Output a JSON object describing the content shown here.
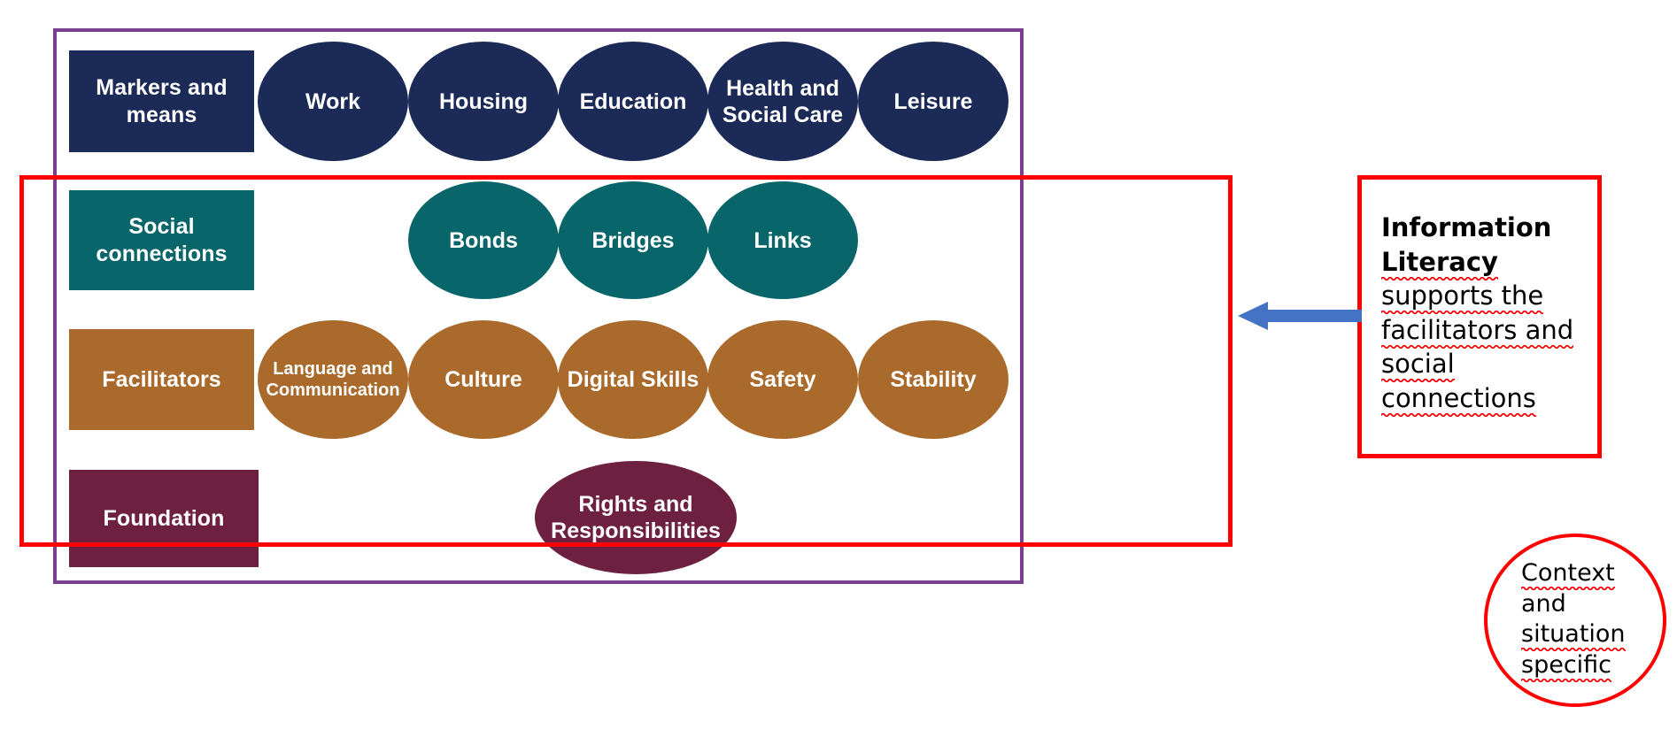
{
  "diagram": {
    "title": "Markers and means / Social connections / Facilitators / Foundation framework",
    "colors": {
      "navy": "#1c2a57",
      "teal": "#08666a",
      "ochre": "#a96a2c",
      "maroon": "#6d2040",
      "outer_frame_purple": "#7b3f8f",
      "highlight_red": "#ff0000",
      "arrow_blue": "#4472c4",
      "node_text": "#ffffff",
      "note_text": "#000000"
    },
    "rows": [
      {
        "id": "markers-and-means",
        "category_label": "Markers and means",
        "color": "#1c2a57",
        "nodes": [
          {
            "label": "Work"
          },
          {
            "label": "Housing"
          },
          {
            "label": "Education"
          },
          {
            "label": "Health and Social Care"
          },
          {
            "label": "Leisure"
          }
        ]
      },
      {
        "id": "social-connections",
        "category_label": "Social connections",
        "color": "#08666a",
        "nodes": [
          {
            "label": "Bonds"
          },
          {
            "label": "Bridges"
          },
          {
            "label": "Links"
          }
        ]
      },
      {
        "id": "facilitators",
        "category_label": "Facilitators",
        "color": "#a96a2c",
        "nodes": [
          {
            "label": "Language and Communication"
          },
          {
            "label": "Culture"
          },
          {
            "label": "Digital Skills"
          },
          {
            "label": "Safety"
          },
          {
            "label": "Stability"
          }
        ]
      },
      {
        "id": "foundation",
        "category_label": "Foundation",
        "color": "#6d2040",
        "nodes": [
          {
            "label": "Rights and Responsibilities"
          }
        ]
      }
    ]
  },
  "annotations": {
    "note": {
      "heading": "Information Literacy",
      "body": " supports the facilitators and social connections",
      "line1": "Information",
      "line2": "Literacy",
      "line3": "supports the",
      "line4": "facilitators and",
      "line5": "social",
      "line6": "connections"
    },
    "circle": {
      "line1": "Context",
      "line2": "and",
      "line3": "situation",
      "line4": "specific",
      "full_text": "Context and situation specific"
    },
    "arrow": {
      "direction": "left",
      "icon": "left-arrow-icon"
    }
  }
}
